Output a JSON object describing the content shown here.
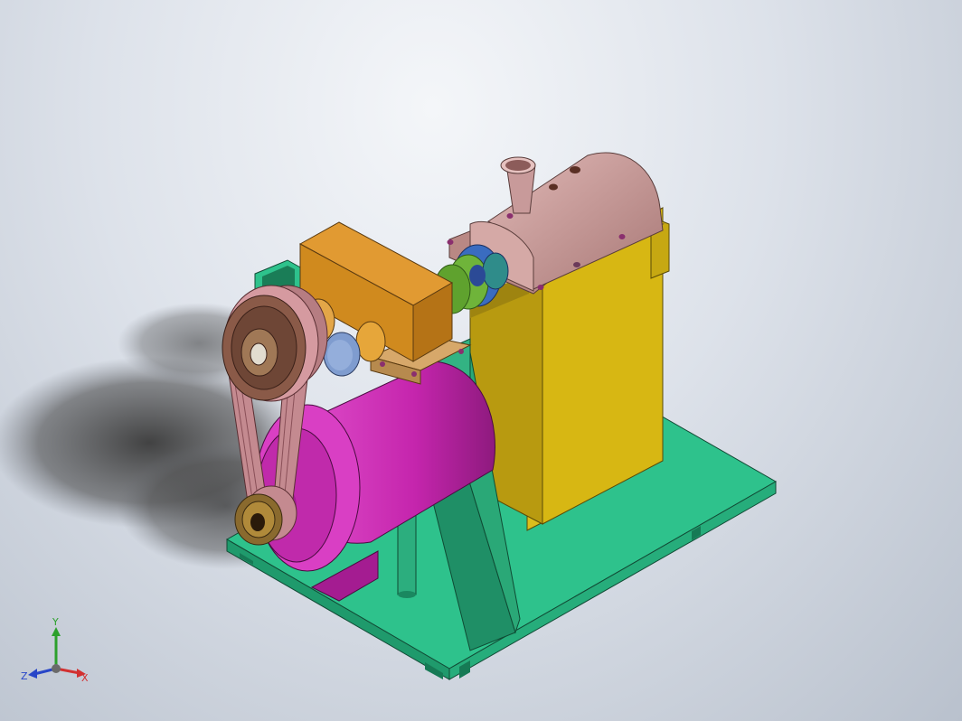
{
  "viewport": {
    "background_top": "#f2f4f8",
    "background_bottom": "#b9c1cd"
  },
  "model": {
    "colors": {
      "base_plate": "#2ec28c",
      "frame": "#1f8f66",
      "housing_yellow": "#dcbe1c",
      "barrel_pink": "#c89a9a",
      "gearbox_orange": "#d08a1e",
      "motor_magenta": "#cc2fb4",
      "pulley_brown": "#8a5a48",
      "belt": "#c48a90",
      "coupling_green": "#6fb43a",
      "coupling_blue": "#3a6cc0",
      "bearing_blue": "#7f9ccf"
    }
  },
  "triad": {
    "y_label": "Y",
    "z_label": "Z",
    "x_label": "X",
    "colors": {
      "x": "#d23030",
      "y": "#2ca02c",
      "z": "#2846c8"
    }
  }
}
